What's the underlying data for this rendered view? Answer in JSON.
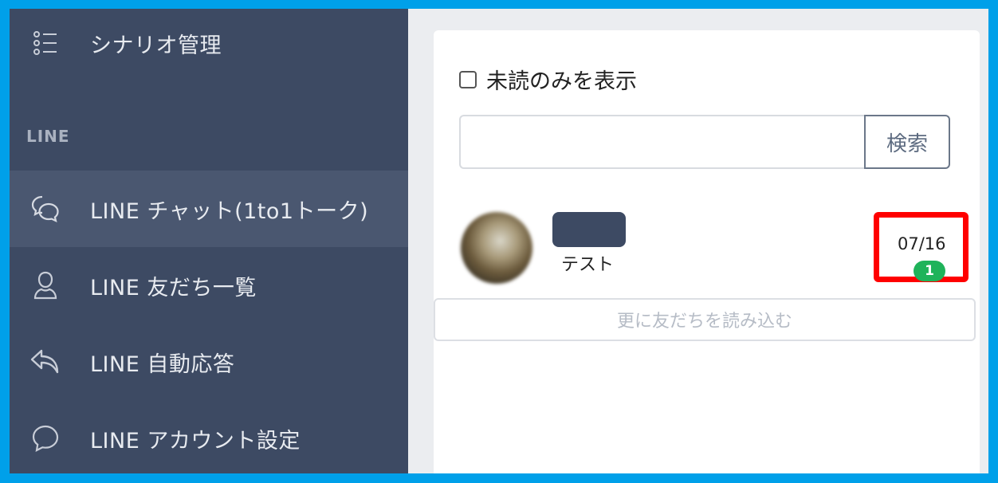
{
  "sidebar": {
    "scenario_label": "シナリオ管理",
    "section_title": "LINE",
    "items": [
      {
        "label": "LINE チャット(1to1トーク)",
        "icon": "chat-bubbles-icon",
        "active": true
      },
      {
        "label": "LINE 友だち一覧",
        "icon": "person-icon",
        "active": false
      },
      {
        "label": "LINE 自動応答",
        "icon": "reply-arrow-icon",
        "active": false
      },
      {
        "label": "LINE アカウント設定",
        "icon": "speech-bubble-icon",
        "active": false
      }
    ]
  },
  "main": {
    "filter_label": "未読のみを表示",
    "filter_checked": false,
    "search_value": "",
    "search_button": "検索",
    "friends": [
      {
        "label": "テスト",
        "date": "07/16",
        "unread": "1"
      }
    ],
    "load_more": "更に友だちを読み込む"
  },
  "colors": {
    "sidebar_bg": "#3d4a63",
    "sidebar_active": "#4a5770",
    "badge": "#1fb35a",
    "highlight": "#ff0000",
    "frame": "#00a0e9"
  }
}
